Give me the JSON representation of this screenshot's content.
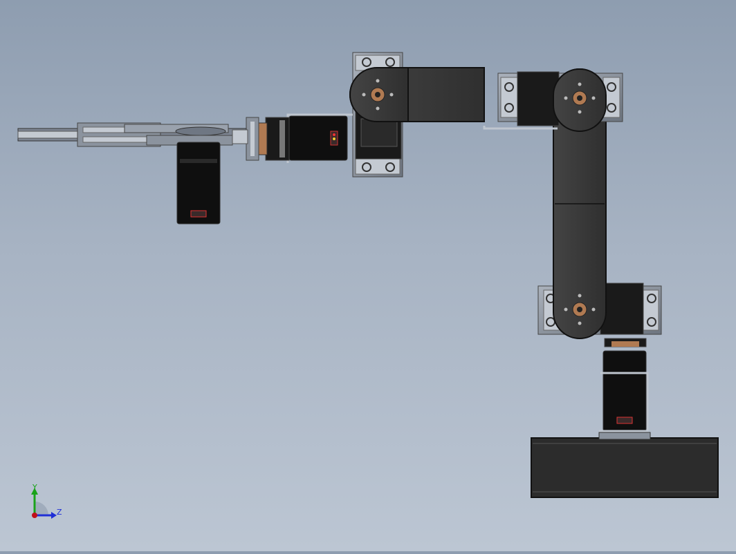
{
  "window": {
    "title": ""
  },
  "triad": {
    "y_label": "Y",
    "z_label": "Z",
    "colors": {
      "y": "#1aa31a",
      "z": "#1f2fd6",
      "x": "#c0101a"
    }
  },
  "model": {
    "name": "robotic-arm-assembly",
    "colors": {
      "body": "#3a3a3a",
      "body_dark": "#1a1a1a",
      "bracket": "#7d8592",
      "bracket_light": "#c4cad2",
      "horn": "#b07a52",
      "servo_black": "#0f0f0f",
      "base": "#2c2c2c"
    }
  }
}
